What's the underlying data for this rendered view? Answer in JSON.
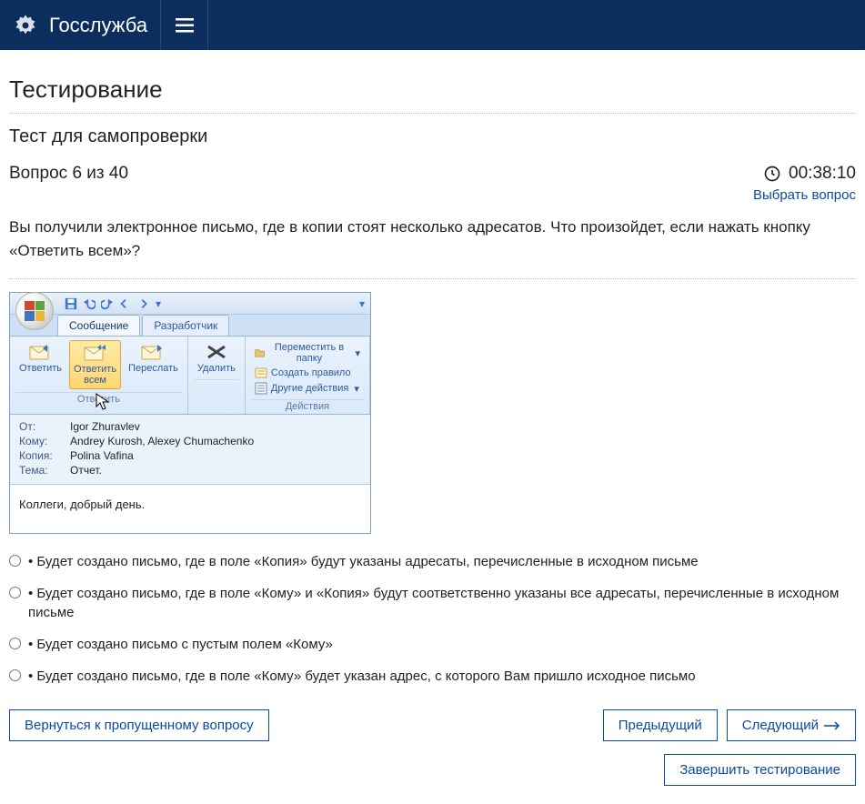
{
  "header": {
    "brand": "Госслужба"
  },
  "page": {
    "title": "Тестирование",
    "test_title": "Тест для самопроверки",
    "question_label": "Вопрос 6 из 40",
    "timer": "00:38:10",
    "select_question": "Выбрать вопрос",
    "question_text": "Вы получили электронное письмо, где в копии стоят несколько адресатов. Что произойдет, если нажать кнопку «Ответить всем»?"
  },
  "outlook": {
    "tabs": {
      "message": "Сообщение",
      "developer": "Разработчик"
    },
    "buttons": {
      "reply": "Ответить",
      "reply_all_line1": "Ответить",
      "reply_all_line2": "всем",
      "forward": "Переслать",
      "delete": "Удалить"
    },
    "group_reply": "Ответить",
    "group_actions": "Действия",
    "actions": {
      "move": "Переместить в папку",
      "rule": "Создать правило",
      "other": "Другие действия"
    },
    "headers": {
      "from_label": "От:",
      "from": "Igor Zhuravlev",
      "to_label": "Кому:",
      "to": "Andrey Kurosh, Alexey Chumachenko",
      "cc_label": "Копия:",
      "cc": "Polina Vafina",
      "subject_label": "Тема:",
      "subject": "Отчет."
    },
    "body": "Коллеги, добрый день."
  },
  "answers": [
    "• Будет создано письмо, где в поле «Копия» будут указаны адресаты, перечисленные в исходном письме",
    "• Будет создано письмо, где в поле «Кому» и «Копия» будут соответственно указаны все адресаты, перечисленные в исходном письме",
    "• Будет создано письмо с пустым полем «Кому»",
    "• Будет создано письмо, где в поле «Кому» будет указан адрес, с которого Вам пришло исходное письмо"
  ],
  "nav": {
    "back_skipped": "Вернуться к пропущенному вопросу",
    "prev": "Предыдущий",
    "next": "Следующий",
    "finish": "Завершить тестирование"
  }
}
